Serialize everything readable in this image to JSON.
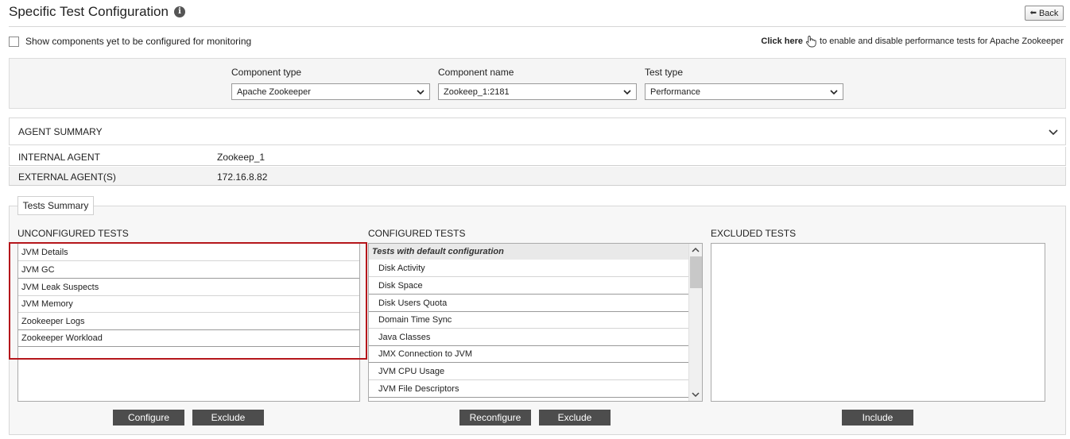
{
  "header": {
    "title": "Specific Test Configuration",
    "info_glyph": "i",
    "back_label": "Back"
  },
  "options": {
    "show_unconfigured_label": "Show components yet to be configured for monitoring",
    "click_here_label": "Click here",
    "click_here_suffix": "to enable and disable performance tests for Apache Zookeeper"
  },
  "filters": {
    "component_type": {
      "label": "Component type",
      "value": "Apache Zookeeper"
    },
    "component_name": {
      "label": "Component name",
      "value": "Zookeep_1:2181"
    },
    "test_type": {
      "label": "Test type",
      "value": "Performance"
    }
  },
  "agent_summary": {
    "title": "AGENT SUMMARY",
    "rows": [
      {
        "label": "INTERNAL AGENT",
        "value": "Zookeep_1"
      },
      {
        "label": "EXTERNAL AGENT(S)",
        "value": "172.16.8.82"
      }
    ]
  },
  "tests_summary": {
    "tab_label": "Tests Summary",
    "unconfigured": {
      "title": "UNCONFIGURED TESTS",
      "items": [
        "JVM Details",
        "JVM GC",
        "JVM Leak Suspects",
        "JVM Memory",
        "Zookeeper Logs",
        "Zookeeper Workload"
      ]
    },
    "configured": {
      "title": "CONFIGURED TESTS",
      "group_header": "Tests with default configuration",
      "items": [
        "Disk Activity",
        "Disk Space",
        "Disk Users Quota",
        "Domain Time Sync",
        "Java Classes",
        "JMX Connection to JVM",
        "JVM CPU Usage",
        "JVM File Descriptors"
      ]
    },
    "excluded": {
      "title": "EXCLUDED TESTS",
      "items": []
    },
    "buttons": {
      "configure": "Configure",
      "exclude_unconfigured": "Exclude",
      "reconfigure": "Reconfigure",
      "exclude_configured": "Exclude",
      "include": "Include"
    }
  },
  "colors": {
    "highlight": "#b5161b",
    "button_bg": "#4d4d4d"
  }
}
